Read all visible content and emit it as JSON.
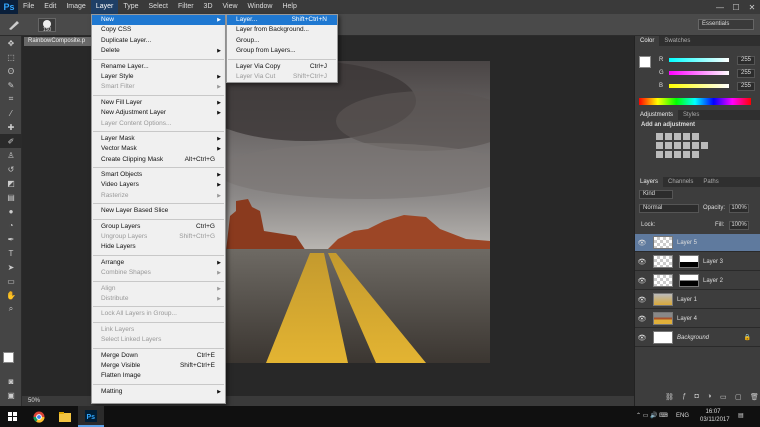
{
  "app": {
    "logo": "Ps"
  },
  "menubar": {
    "items": [
      "File",
      "Edit",
      "Image",
      "Layer",
      "Type",
      "Select",
      "Filter",
      "3D",
      "View",
      "Window",
      "Help"
    ],
    "active_index": 3
  },
  "window_controls": {
    "minimize": "—",
    "maximize": "☐",
    "close": "✕"
  },
  "options": {
    "brush_size": "150",
    "workspace": "Essentials"
  },
  "document": {
    "tab_title": "RainbowComposite.p",
    "zoom": "50%"
  },
  "layer_menu": {
    "new": "New",
    "copy_css": "Copy CSS",
    "duplicate": "Duplicate Layer...",
    "delete": "Delete",
    "rename": "Rename Layer...",
    "layer_style": "Layer Style",
    "smart_filter": "Smart Filter",
    "new_fill": "New Fill Layer",
    "new_adjust": "New Adjustment Layer",
    "content_options": "Layer Content Options...",
    "layer_mask": "Layer Mask",
    "vector_mask": "Vector Mask",
    "clipping_mask": "Create Clipping Mask",
    "clipping_mask_sc": "Alt+Ctrl+G",
    "smart_objects": "Smart Objects",
    "video_layers": "Video Layers",
    "rasterize": "Rasterize",
    "slice": "New Layer Based Slice",
    "group": "Group Layers",
    "group_sc": "Ctrl+G",
    "ungroup": "Ungroup Layers",
    "ungroup_sc": "Shift+Ctrl+G",
    "hide": "Hide Layers",
    "arrange": "Arrange",
    "combine": "Combine Shapes",
    "align": "Align",
    "distribute": "Distribute",
    "lock": "Lock All Layers in Group...",
    "link": "Link Layers",
    "select_linked": "Select Linked Layers",
    "merge_down": "Merge Down",
    "merge_down_sc": "Ctrl+E",
    "merge_visible": "Merge Visible",
    "merge_visible_sc": "Shift+Ctrl+E",
    "flatten": "Flatten Image",
    "matting": "Matting"
  },
  "new_submenu": {
    "layer": "Layer...",
    "layer_sc": "Shift+Ctrl+N",
    "from_bg": "Layer from Background...",
    "group": "Group...",
    "group_from": "Group from Layers...",
    "via_copy": "Layer Via Copy",
    "via_copy_sc": "Ctrl+J",
    "via_cut": "Layer Via Cut",
    "via_cut_sc": "Shift+Ctrl+J"
  },
  "color_panel": {
    "tabs": [
      "Color",
      "Swatches"
    ],
    "r_label": "R",
    "g_label": "G",
    "b_label": "B",
    "r": "255",
    "g": "255",
    "b": "255"
  },
  "adjust_panel": {
    "tabs": [
      "Adjustments",
      "Styles"
    ],
    "heading": "Add an adjustment"
  },
  "layers_panel": {
    "tabs": [
      "Layers",
      "Channels",
      "Paths"
    ],
    "kind": "Kind",
    "blend": "Normal",
    "opacity_label": "Opacity:",
    "opacity": "100%",
    "lock_label": "Lock:",
    "fill_label": "Fill:",
    "fill": "100%",
    "layers": [
      "Layer 5",
      "Layer 3",
      "Layer 2",
      "Layer 1",
      "Layer 4",
      "Background"
    ]
  },
  "taskbar": {
    "lang": "ENG",
    "time": "16:07",
    "date": "03/11/2017"
  }
}
